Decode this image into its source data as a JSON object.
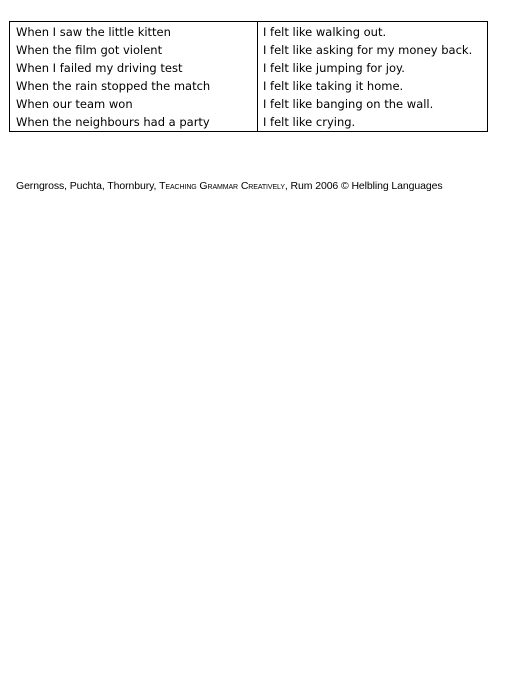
{
  "worksheet": {
    "rows": [
      {
        "left": "When I saw the little kitten",
        "right": "I felt like walking out."
      },
      {
        "left": "When the film got violent",
        "right": "I felt like asking for my money back."
      },
      {
        "left": "When I failed my driving test",
        "right": "I felt like jumping for joy."
      },
      {
        "left": "When the rain stopped the match",
        "right": "I felt like taking it home."
      },
      {
        "left": "When our team won",
        "right": "I felt like banging on the wall."
      },
      {
        "left": "When the neighbours had a party",
        "right": "I felt like crying."
      }
    ]
  },
  "credit": {
    "authors": "Gerngross, Puchta, Thornbury, ",
    "title": "Teaching Grammar Creatively",
    "publisher": ", Rum 2006 © Helbling Languages"
  }
}
